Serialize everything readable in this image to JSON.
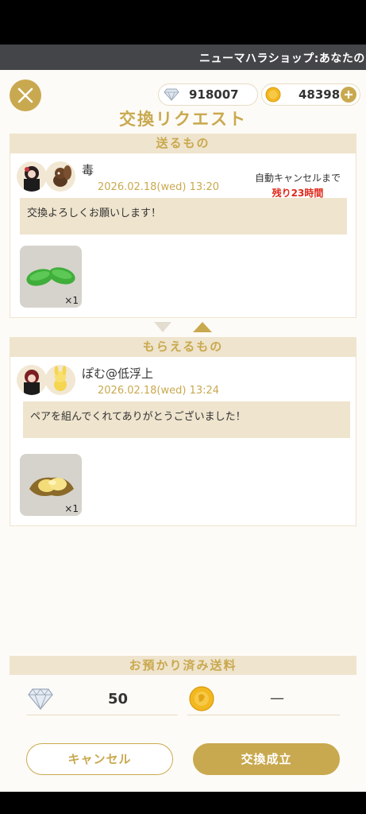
{
  "header": {
    "marquee": "ニューマハラショップ:あなたの"
  },
  "currency": {
    "diamonds": "918007",
    "coins": "48398"
  },
  "title": "交換リクエスト",
  "send_section": {
    "header": "送るもの",
    "username": "毒",
    "datetime": "2026.02.18(wed) 13:20",
    "auto_cancel_label": "自動キャンセルまで",
    "remaining": "残り23時間",
    "message": "交換よろしくお願いします！",
    "item_qty": "×1"
  },
  "receive_section": {
    "header": "もらえるもの",
    "username": "ぽむ@低浮上",
    "datetime": "2026.02.18(wed) 13:24",
    "message": "ペアを組んでくれてありがとうございました！",
    "item_qty": "×1"
  },
  "deposit": {
    "header": "お預かり済み送料",
    "diamond_fee": "50",
    "coin_fee": "—"
  },
  "buttons": {
    "cancel": "キャンセル",
    "confirm": "交換成立"
  },
  "colors": {
    "accent_gold": "#c9a94f",
    "header_bg": "#efe4cd",
    "alert_red": "#e0281a",
    "topbar": "#444548"
  }
}
